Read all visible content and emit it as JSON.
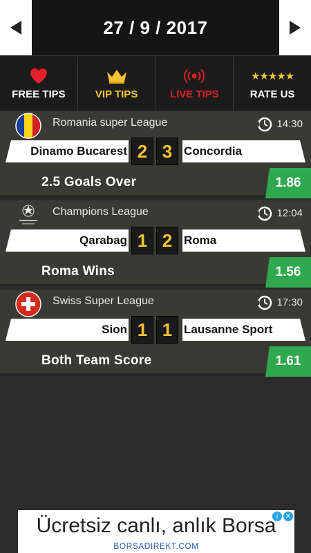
{
  "header": {
    "date": "27 / 9 / 2017"
  },
  "tabs": [
    {
      "label": "FREE TIPS",
      "icon": "heart-icon",
      "color": "#ffffff"
    },
    {
      "label": "VIP TIPS",
      "icon": "crown-icon",
      "color": "#f4c430"
    },
    {
      "label": "LIVE TIPS",
      "icon": "broadcast-icon",
      "color": "#e02020"
    },
    {
      "label": "RATE US",
      "icon": "five-stars-icon",
      "stars": "★★★★★",
      "color": "#ffffff"
    }
  ],
  "matches": [
    {
      "league": "Romania super League",
      "time": "14:30",
      "home": "Dinamo Bucarest",
      "home_score": "2",
      "away_score": "3",
      "away": "Concordia",
      "tip": "2.5 Goals Over",
      "odds": "1.86"
    },
    {
      "league": "Champions League",
      "time": "12:04",
      "home": "Qarabag",
      "home_score": "1",
      "away_score": "2",
      "away": "Roma",
      "tip": "Roma Wins",
      "odds": "1.56"
    },
    {
      "league": "Swiss Super League",
      "time": "17:30",
      "home": "Sion",
      "home_score": "1",
      "away_score": "1",
      "away": "Lausanne Sport",
      "tip": "Both Team Score",
      "odds": "1.61"
    }
  ],
  "ad": {
    "text": "Ücretsiz canlı, anlık Borsa",
    "brand": "BORSADIREKT.COM",
    "info": "i",
    "close": "✕"
  },
  "colors": {
    "accent_gold": "#f4c430",
    "odds_green": "#2fa84f",
    "live_red": "#e02020"
  }
}
